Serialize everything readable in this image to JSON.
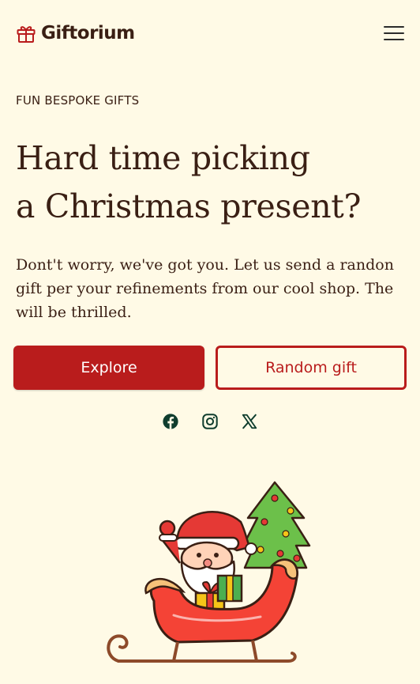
{
  "brand": {
    "name": "Giftorium",
    "icon": "gift-icon",
    "accent": "#b91c1c",
    "background": "#fffae6",
    "text_color": "#3a1f14"
  },
  "header": {
    "menu_icon": "hamburger-menu-icon"
  },
  "hero": {
    "eyebrow": "FUN BESPOKE GIFTS",
    "headline_lines": [
      "Hard time picking",
      "a Christmas present?"
    ],
    "lead_lines": [
      "Dont't worry, we've got you. Let us send a randon",
      "gift per your refinements from our cool shop. The",
      "will be thrilled."
    ],
    "primary_button": "Explore",
    "secondary_button": "Random gift",
    "illustration": "santa-in-sleigh-illustration"
  },
  "socials": [
    {
      "icon": "facebook-icon"
    },
    {
      "icon": "instagram-icon"
    },
    {
      "icon": "x-twitter-icon"
    }
  ]
}
